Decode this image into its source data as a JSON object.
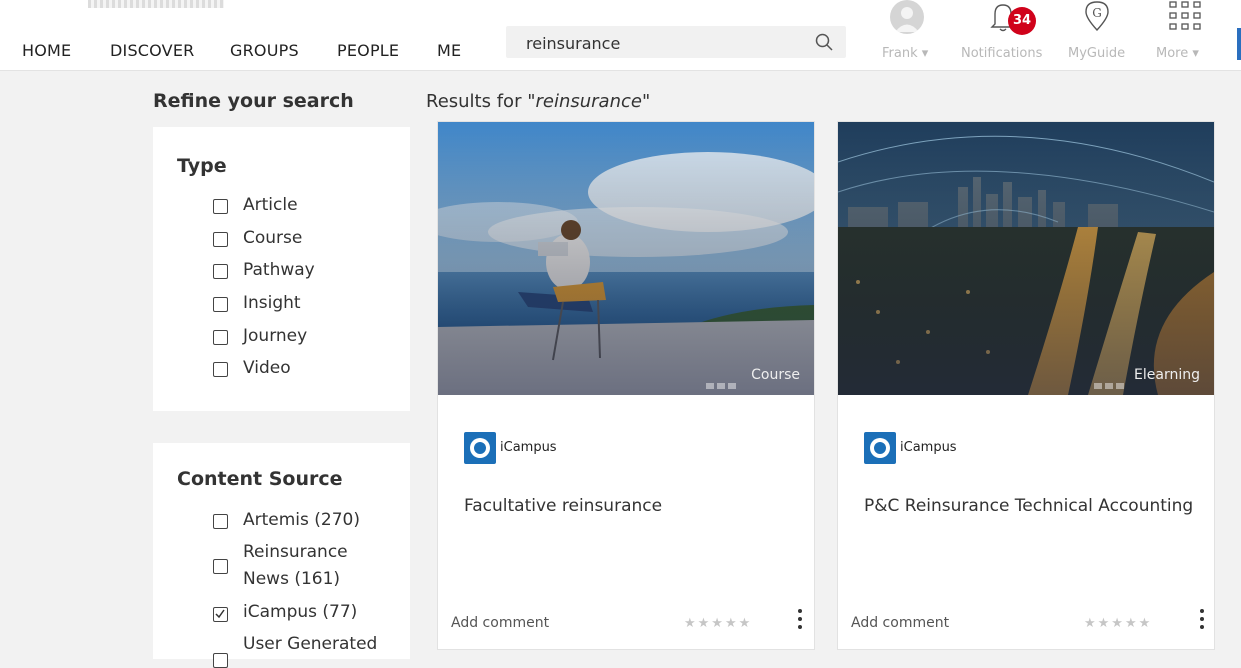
{
  "nav": {
    "items": [
      "HOME",
      "DISCOVER",
      "GROUPS",
      "PEOPLE",
      "ME"
    ]
  },
  "search": {
    "value": "reinsurance"
  },
  "header": {
    "user_label": "Frank ▾",
    "notifications_label": "Notifications",
    "notifications_count": "34",
    "myguide_label": "MyGuide",
    "more_label": "More ▾"
  },
  "refine": {
    "title": "Refine your search",
    "type": {
      "heading": "Type",
      "options": [
        "Article",
        "Course",
        "Pathway",
        "Insight",
        "Journey",
        "Video"
      ]
    },
    "source": {
      "heading": "Content Source",
      "options": [
        {
          "label": "Artemis (270)",
          "checked": false
        },
        {
          "label": "Reinsurance News (161)",
          "checked": false
        },
        {
          "label": "iCampus (77)",
          "checked": true
        },
        {
          "label": "User Generated",
          "checked": false
        }
      ]
    }
  },
  "results": {
    "prefix": "Results for ",
    "query": "\"reinsurance\"",
    "cards": [
      {
        "type": "Course",
        "provider": "iCampus",
        "title": "Facultative reinsurance",
        "comment_label": "Add comment",
        "stars": "★★★★★"
      },
      {
        "type": "Elearning",
        "provider": "iCampus",
        "title": "P&C Reinsurance Technical Accounting",
        "comment_label": "Add comment",
        "stars": "★★★★★"
      }
    ]
  },
  "colors": {
    "accent": "#1b6fb8",
    "badge": "#d0021b",
    "background": "#f2f2f2"
  }
}
